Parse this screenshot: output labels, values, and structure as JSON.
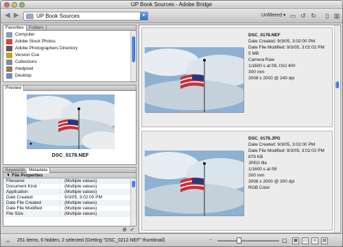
{
  "window": {
    "title": "UP Book Sources - Adobe Bridge"
  },
  "toolbar": {
    "back_icon": "back-arrow-icon",
    "forward_icon": "forward-arrow-icon",
    "path_value": "UP Book Sources",
    "filter_label": "Unfiltered",
    "accent": "#3d7fd9"
  },
  "favorites": {
    "tabs": [
      "Favorites",
      "Folders"
    ],
    "items": [
      {
        "label": "Computer",
        "icon": "computer-icon",
        "color": "#8d9db3"
      },
      {
        "label": "Adobe Stock Photos",
        "icon": "stock-photos-icon",
        "color": "#d3463a"
      },
      {
        "label": "Adobe Photographers Directory",
        "icon": "directory-icon",
        "color": "#5a5a5a"
      },
      {
        "label": "Version Cue",
        "icon": "version-cue-icon",
        "color": "#c89c2a"
      },
      {
        "label": "Collections",
        "icon": "collections-icon",
        "color": "#7b8da6"
      },
      {
        "label": "rhedpixel",
        "icon": "user-folder-icon",
        "color": "#9a7b55"
      },
      {
        "label": "Desktop",
        "icon": "desktop-icon",
        "color": "#6a8fc5"
      }
    ]
  },
  "preview": {
    "tab": "Preview",
    "filename": "DSC_0178.NEF"
  },
  "metadata": {
    "tabs": [
      "Keywords",
      "Metadata"
    ],
    "section": "File Properties",
    "rows": [
      {
        "key": "Filename",
        "value": "(Multiple values)"
      },
      {
        "key": "Document Kind",
        "value": "(Multiple values)"
      },
      {
        "key": "Application",
        "value": "(Multiple values)"
      },
      {
        "key": "Date Created",
        "value": "9/3/05, 3:02:00 PM"
      },
      {
        "key": "Date File Created",
        "value": "(Multiple values)"
      },
      {
        "key": "Date File Modified",
        "value": "(Multiple values)"
      },
      {
        "key": "File Size",
        "value": "(Multiple values)"
      }
    ]
  },
  "content": {
    "items": [
      {
        "filename": "DSC_0178.NEF",
        "lines": [
          "Date Created: 9/3/05, 3:02:00 PM",
          "Date File Modified: 9/3/05, 3:02:02 PM",
          "5 MB",
          "Camera Raw",
          "1/1600 s at f/8, ISO 400",
          "300 mm",
          "3008 x 2000 @ 240 dpi"
        ]
      },
      {
        "filename": "DSC_0178.JPG",
        "lines": [
          "Date Created: 9/3/05, 3:02:00 PM",
          "Date File Modified: 9/3/05, 3:02:02 PM",
          "879 KB",
          "JPEG file",
          "1/1600 s at f/8",
          "300 mm",
          "3008 x 2000 @ 300 dpi",
          "RGB Color"
        ]
      }
    ]
  },
  "status": {
    "text": "251 items, 6 hidden, 2 selected (Getting \"DSC_0212.NEF\" thumbnail)"
  }
}
